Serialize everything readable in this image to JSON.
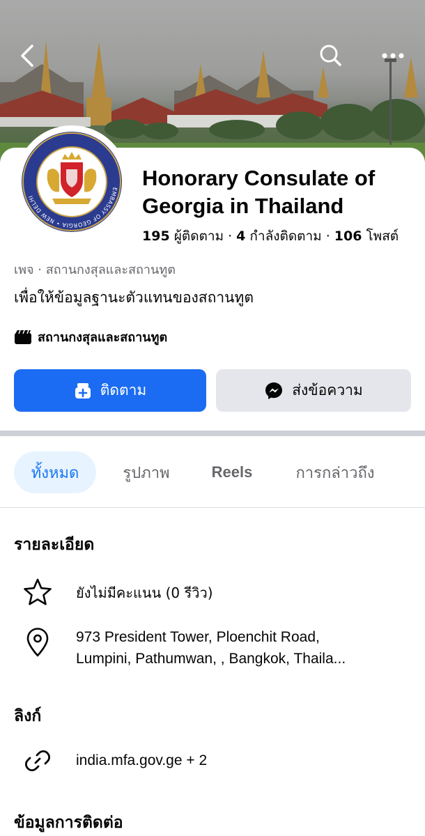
{
  "header": {
    "back_icon": "chevron-left-icon",
    "search_icon": "search-icon",
    "more_icon": "more-horizontal-icon"
  },
  "profile": {
    "avatar_seal_text": "EMBASSY OF GEORGIA • NEW DELHI",
    "name": "Honorary Consulate of Georgia in Thailand",
    "followers_count": "195",
    "followers_label": "ผู้ติดตาม",
    "following_count": "4",
    "following_label": "กำลังติดตาม",
    "posts_count": "106",
    "posts_label": "โพสต์",
    "category": "เพจ · สถานกงสุลและสถานทูต",
    "bio": "เพื่อให้ข้อมูลฐานะตัวแทนของสถานทูต",
    "category_line": "สถานกงสุลและสถานทูต"
  },
  "actions": {
    "follow_label": "ติดตาม",
    "message_label": "ส่งข้อความ",
    "follow_color": "#1b6cf2",
    "message_bg": "#e4e6eb"
  },
  "tabs": [
    {
      "label": "ทั้งหมด",
      "active": true
    },
    {
      "label": "รูปภาพ",
      "active": false
    },
    {
      "label": "Reels",
      "active": false
    },
    {
      "label": "การกล่าวถึง",
      "active": false
    }
  ],
  "details": {
    "title": "รายละเอียด",
    "rating": "ยังไม่มีคะแนน (0 รีวิว)",
    "address_line1": "973 President Tower, Ploenchit Road,",
    "address_line2": "Lumpini, Pathumwan, , Bangkok, Thaila..."
  },
  "links": {
    "title": "ลิงก์",
    "website": "india.mfa.gov.ge + 2"
  },
  "contact": {
    "title": "ข้อมูลการติดต่อ"
  }
}
